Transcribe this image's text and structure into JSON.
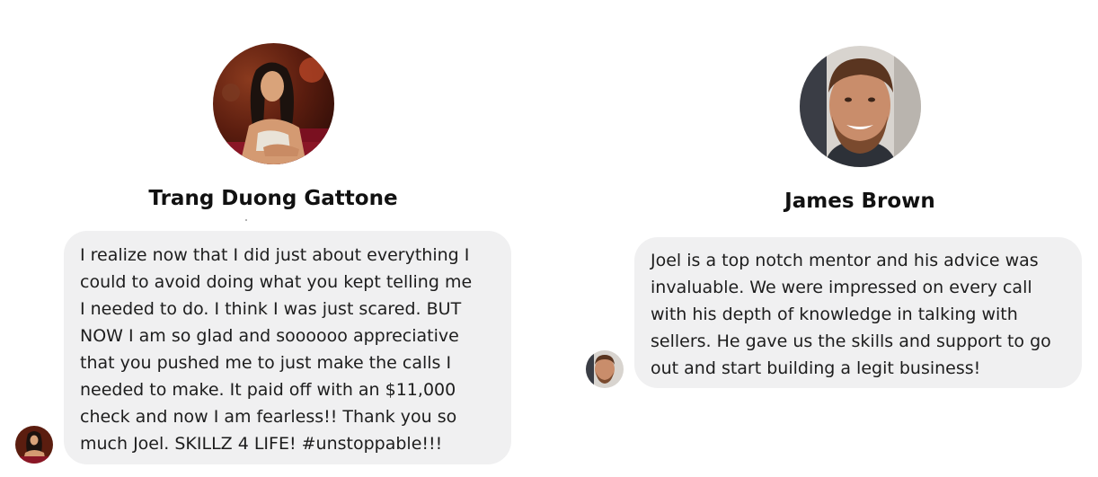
{
  "testimonials": [
    {
      "name": "Trang Duong Gattone",
      "avatar_icon": "woman-portrait-photo",
      "message": "I realize now that I did just about everything I\ncould to avoid doing what you kept telling me\nI needed to do.  I think I was just scared. BUT\nNOW I am so glad and soooooo appreciative\nthat you pushed me to just make the calls I\nneeded to make.  It paid off with an $11,000\ncheck and now I am fearless!! Thank you so\nmuch Joel.  SKILLZ 4 LIFE! #unstoppable!!!"
    },
    {
      "name": "James Brown",
      "avatar_icon": "bearded-man-portrait-photo",
      "message": "Joel is a top notch mentor and his advice was\ninvaluable. We were impressed on every call\nwith his depth of knowledge in talking with\nsellers. He gave us the skills and support to go\nout and start building a legit business!"
    }
  ],
  "colors": {
    "bubble_background": "#f0f0f1",
    "text": "#1d1d1d",
    "name": "#111111",
    "page_background": "#ffffff"
  }
}
